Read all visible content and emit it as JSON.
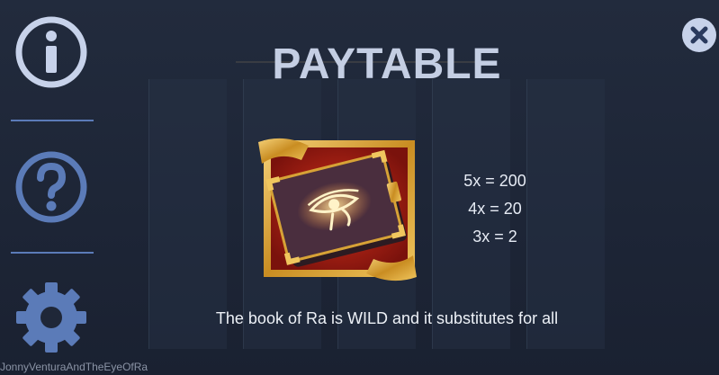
{
  "title": "PAYTABLE",
  "sidebar": {
    "buttons": [
      {
        "name": "info",
        "icon": "info-icon"
      },
      {
        "name": "help",
        "icon": "help-icon"
      },
      {
        "name": "settings",
        "icon": "gear-icon"
      }
    ]
  },
  "close_icon": "close-icon",
  "symbol": {
    "name": "book-of-ra-icon",
    "payouts": [
      "5x = 200",
      "4x = 20",
      "3x = 2"
    ]
  },
  "description": "The book of Ra is WILD and it substitutes for all",
  "footer": "JonnyVenturaAndTheEyeOfRa",
  "colors": {
    "title": "#c4cee3",
    "icon": "#c7d2ea",
    "icon_blue": "#5b7bb8",
    "background": "#1f2738",
    "gold": "#d7a236",
    "book": "#4a2e3e"
  }
}
